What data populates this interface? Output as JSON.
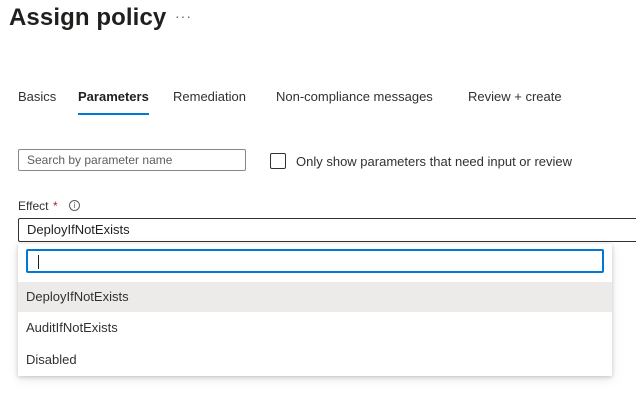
{
  "header": {
    "title": "Assign policy",
    "more_label": "···"
  },
  "tabs": [
    {
      "label": "Basics",
      "active": false
    },
    {
      "label": "Parameters",
      "active": true
    },
    {
      "label": "Remediation",
      "active": false
    },
    {
      "label": "Non-compliance messages",
      "active": false
    },
    {
      "label": "Review + create",
      "active": false
    }
  ],
  "filters": {
    "search_placeholder": "Search by parameter name",
    "checkbox_label": "Only show parameters that need input or review",
    "checkbox_checked": false
  },
  "effect": {
    "label": "Effect",
    "required_marker": "*",
    "info_glyph": "i",
    "selected_value": "DeployIfNotExists",
    "filter_value": "",
    "options": [
      "DeployIfNotExists",
      "AuditIfNotExists",
      "Disabled"
    ]
  },
  "colors": {
    "accent": "#0078d4",
    "required": "#a4262c",
    "selected_option_bg": "#edebe9"
  }
}
